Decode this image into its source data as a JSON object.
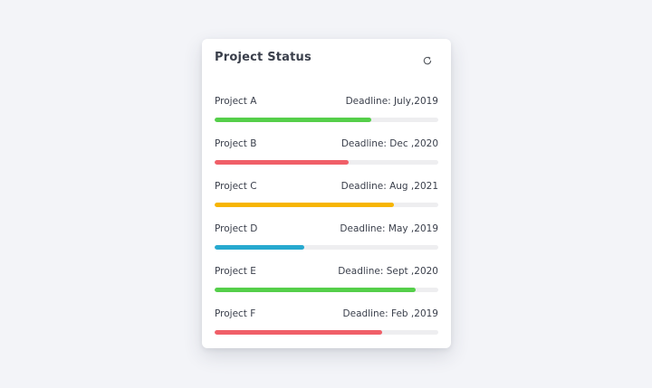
{
  "card": {
    "title": "Project Status",
    "refresh_icon": "refresh-icon"
  },
  "projects": [
    {
      "name": "Project A",
      "deadline": "Deadline: July,2019",
      "progress": 0.7,
      "color": "#55cf4a"
    },
    {
      "name": "Project B",
      "deadline": "Deadline: Dec ,2020",
      "progress": 0.6,
      "color": "#f05f68"
    },
    {
      "name": "Project C",
      "deadline": "Deadline: Aug ,2021",
      "progress": 0.8,
      "color": "#f7b500"
    },
    {
      "name": "Project D",
      "deadline": "Deadline: May ,2019",
      "progress": 0.4,
      "color": "#27a9cf"
    },
    {
      "name": "Project E",
      "deadline": "Deadline: Sept ,2020",
      "progress": 0.9,
      "color": "#55cf4a"
    },
    {
      "name": "Project F",
      "deadline": "Deadline: Feb ,2019",
      "progress": 0.75,
      "color": "#f05f68"
    }
  ]
}
